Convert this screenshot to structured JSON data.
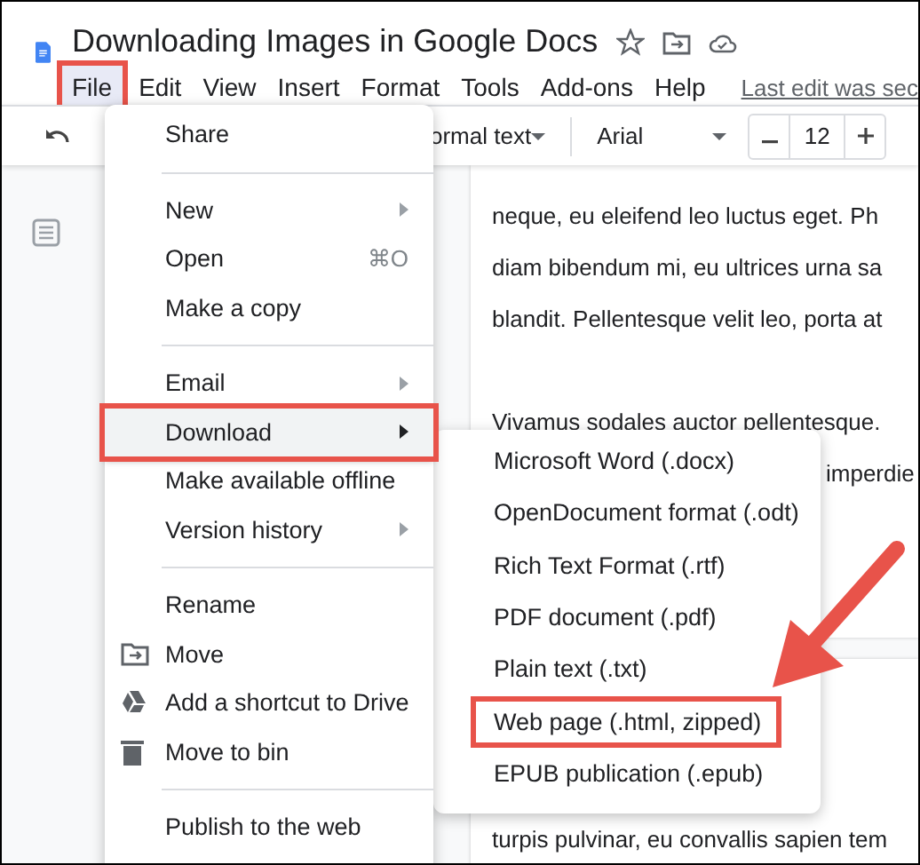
{
  "document": {
    "title": "Downloading Images in Google Docs"
  },
  "menu_bar": [
    {
      "label": "File",
      "selected": true
    },
    {
      "label": "Edit",
      "selected": false
    },
    {
      "label": "View",
      "selected": false
    },
    {
      "label": "Insert",
      "selected": false
    },
    {
      "label": "Format",
      "selected": false
    },
    {
      "label": "Tools",
      "selected": false
    },
    {
      "label": "Add-ons",
      "selected": false
    },
    {
      "label": "Help",
      "selected": false
    }
  ],
  "last_edit": "Last edit was sec",
  "toolbar": {
    "style": "ormal text",
    "font": "Arial",
    "font_size": "12"
  },
  "page_1": [
    {
      "kind": "line",
      "text": "neque, eu eleifend leo luctus eget. Ph"
    },
    {
      "kind": "line",
      "text": "diam bibendum mi, eu ultrices urna sa"
    },
    {
      "kind": "line",
      "text": "blandit. Pellentesque velit leo, porta at"
    },
    {
      "kind": "blank"
    },
    {
      "kind": "line",
      "text": "Vivamus sodales auctor pellentesque."
    },
    {
      "kind": "tail",
      "text": "imperdie"
    }
  ],
  "page_2": [
    {
      "kind": "line",
      "text": "turpis pulvinar, eu convallis sapien tem"
    }
  ],
  "file_menu": [
    {
      "kind": "item",
      "label": "Share",
      "selected": false
    },
    {
      "kind": "divider"
    },
    {
      "kind": "item",
      "label": "New",
      "submenu": true,
      "selected": false
    },
    {
      "kind": "item",
      "label": "Open",
      "shortcut": "⌘O",
      "selected": false
    },
    {
      "kind": "item",
      "label": "Make a copy",
      "selected": false
    },
    {
      "kind": "divider"
    },
    {
      "kind": "item",
      "label": "Email",
      "submenu": true,
      "selected": false
    },
    {
      "kind": "item",
      "label": "Download",
      "submenu": true,
      "selected": true
    },
    {
      "kind": "item",
      "label": "Make available offline",
      "selected": false
    },
    {
      "kind": "item",
      "label": "Version history",
      "submenu": true,
      "selected": false
    },
    {
      "kind": "divider"
    },
    {
      "kind": "item",
      "label": "Rename",
      "selected": false
    },
    {
      "kind": "item",
      "label": "Move",
      "selected": false
    },
    {
      "kind": "item",
      "label": "Add a shortcut to Drive",
      "selected": false
    },
    {
      "kind": "item",
      "label": "Move to bin",
      "selected": false
    },
    {
      "kind": "divider"
    },
    {
      "kind": "item",
      "label": "Publish to the web",
      "selected": false
    }
  ],
  "download_menu": [
    {
      "label": "Microsoft Word (.docx)",
      "selected": false
    },
    {
      "label": "OpenDocument format (.odt)",
      "selected": false
    },
    {
      "label": "Rich Text Format (.rtf)",
      "selected": false
    },
    {
      "label": "PDF document (.pdf)",
      "selected": false
    },
    {
      "label": "Plain text (.txt)",
      "selected": false
    },
    {
      "label": "Web page (.html, zipped)",
      "selected": true
    },
    {
      "label": "EPUB publication (.epub)",
      "selected": false
    }
  ]
}
